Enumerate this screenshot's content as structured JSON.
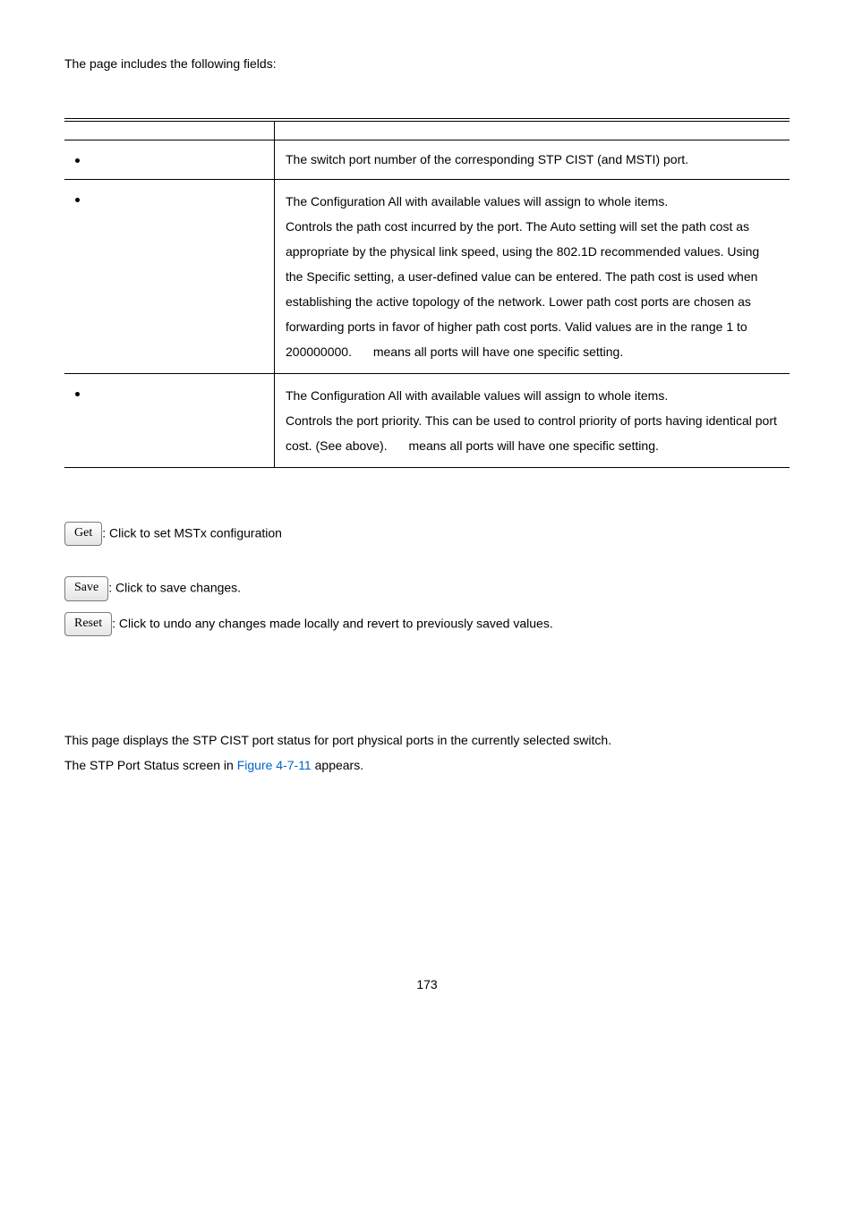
{
  "intro": "The page includes the following fields:",
  "table": {
    "rows": [
      {
        "left": "The switch port number of the corresponding STP CIST (and MSTI) port."
      },
      {
        "left_lines": [
          "The Configuration All with available values will assign to whole items.",
          "Controls the path cost incurred by the port. The Auto setting will set the path cost as appropriate by the physical link speed, using the 802.1D recommended values. Using the Specific setting, a user-defined value can be entered. The path cost is used when establishing the active topology of the network. Lower path cost ports are chosen as forwarding ports in favor of higher path cost ports. Valid values are in the range 1 to 200000000.",
          "means all ports will have one specific setting."
        ]
      },
      {
        "left_lines": [
          "The Configuration All with available values will assign to whole items.",
          "Controls the port priority. This can be used to control priority of ports having identical port cost. (See above).",
          "means all ports will have one specific setting."
        ]
      }
    ]
  },
  "buttons": {
    "get": {
      "label": "Get",
      "text": ": Click to set MSTx configuration"
    },
    "save": {
      "label": "Save",
      "text": ": Click to save changes."
    },
    "reset": {
      "label": "Reset",
      "text": ": Click to undo any changes made locally and revert to previously saved values."
    }
  },
  "section": {
    "line1": "This page displays the STP CIST port status for port physical ports in the currently selected switch.",
    "line2_a": "The STP Port Status screen in ",
    "line2_link": "Figure 4-7-11",
    "line2_b": " appears."
  },
  "footer": "173"
}
